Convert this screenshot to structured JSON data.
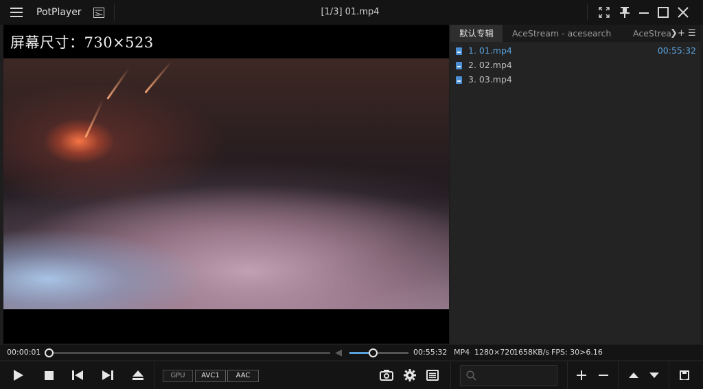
{
  "titlebar": {
    "app_name": "PotPlayer",
    "window_title": "[1/3] 01.mp4"
  },
  "video": {
    "overlay_text": "屏幕尺寸：730×523"
  },
  "playlist": {
    "tabs": [
      "默认专辑",
      "AceStream - acesearch",
      "AceStream"
    ],
    "active_tab": 0,
    "items": [
      {
        "label": "1. 01.mp4",
        "duration": "00:55:32",
        "current": true
      },
      {
        "label": "2. 02.mp4",
        "duration": "",
        "current": false
      },
      {
        "label": "3. 03.mp4",
        "duration": "",
        "current": false
      }
    ]
  },
  "playback": {
    "time_current": "00:00:01",
    "time_total": "00:55:32",
    "progress": 0.0003,
    "volume": 0.4
  },
  "info": {
    "format": "MP4",
    "resolution": "1280×720",
    "bitrate": "1658KB/s",
    "fps": "FPS: 30>6.16"
  },
  "badges": {
    "gpu": "GPU",
    "video_codec": "AVC1",
    "audio_codec": "AAC"
  },
  "colors": {
    "accent": "#5aa2dd",
    "background": "#1e1e1e"
  }
}
